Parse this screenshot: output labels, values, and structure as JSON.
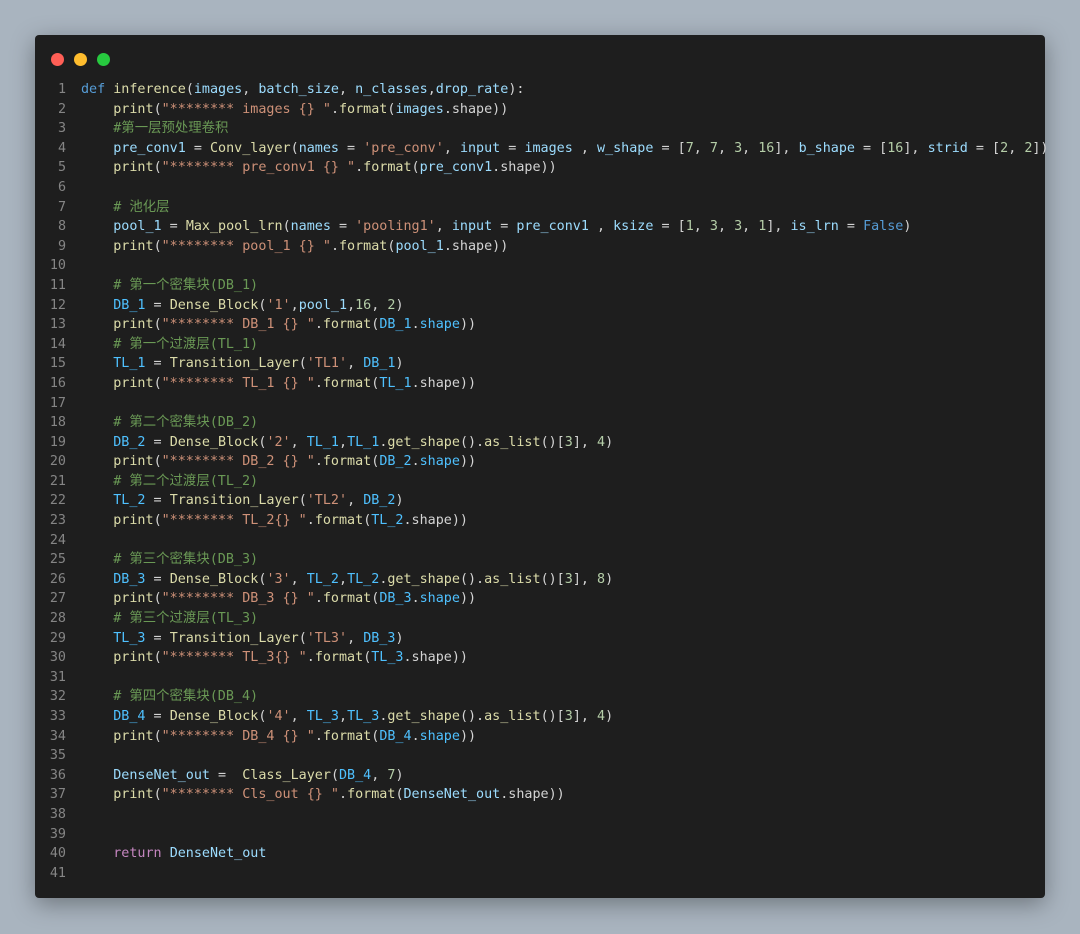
{
  "window_controls": {
    "close_color": "#ff5f56",
    "minimize_color": "#ffbd2e",
    "maximize_color": "#27c93f"
  },
  "code": {
    "language": "python",
    "line_numbers": [
      "1",
      "2",
      "3",
      "4",
      "5",
      "6",
      "7",
      "8",
      "9",
      "10",
      "11",
      "12",
      "13",
      "14",
      "15",
      "16",
      "17",
      "18",
      "19",
      "20",
      "21",
      "22",
      "23",
      "24",
      "25",
      "26",
      "27",
      "28",
      "29",
      "30",
      "31",
      "32",
      "33",
      "34",
      "35",
      "36",
      "37",
      "38",
      "39",
      "40",
      "41"
    ],
    "lines": [
      [
        [
          "kw",
          "def "
        ],
        [
          "fn",
          "inference"
        ],
        [
          "op",
          "("
        ],
        [
          "var",
          "images"
        ],
        [
          "op",
          ", "
        ],
        [
          "var",
          "batch_size"
        ],
        [
          "op",
          ", "
        ],
        [
          "var",
          "n_classes"
        ],
        [
          "op",
          ","
        ],
        [
          "var",
          "drop_rate"
        ],
        [
          "op",
          "):"
        ]
      ],
      [
        [
          "op",
          "    "
        ],
        [
          "fn",
          "print"
        ],
        [
          "op",
          "("
        ],
        [
          "str",
          "\"******** images {} \""
        ],
        [
          "op",
          "."
        ],
        [
          "fn",
          "format"
        ],
        [
          "op",
          "("
        ],
        [
          "var",
          "images"
        ],
        [
          "op",
          ".shape))"
        ]
      ],
      [
        [
          "op",
          "    "
        ],
        [
          "cm",
          "#第一层预处理卷积"
        ]
      ],
      [
        [
          "op",
          "    "
        ],
        [
          "var",
          "pre_conv1"
        ],
        [
          "op",
          " = "
        ],
        [
          "fn",
          "Conv_layer"
        ],
        [
          "op",
          "("
        ],
        [
          "var",
          "names"
        ],
        [
          "op",
          " = "
        ],
        [
          "str",
          "'pre_conv'"
        ],
        [
          "op",
          ", "
        ],
        [
          "var",
          "input"
        ],
        [
          "op",
          " = "
        ],
        [
          "var",
          "images"
        ],
        [
          "op",
          " , "
        ],
        [
          "var",
          "w_shape"
        ],
        [
          "op",
          " = ["
        ],
        [
          "num",
          "7"
        ],
        [
          "op",
          ", "
        ],
        [
          "num",
          "7"
        ],
        [
          "op",
          ", "
        ],
        [
          "num",
          "3"
        ],
        [
          "op",
          ", "
        ],
        [
          "num",
          "16"
        ],
        [
          "op",
          "], "
        ],
        [
          "var",
          "b_shape"
        ],
        [
          "op",
          " = ["
        ],
        [
          "num",
          "16"
        ],
        [
          "op",
          "], "
        ],
        [
          "var",
          "strid"
        ],
        [
          "op",
          " = ["
        ],
        [
          "num",
          "2"
        ],
        [
          "op",
          ", "
        ],
        [
          "num",
          "2"
        ],
        [
          "op",
          "])"
        ]
      ],
      [
        [
          "op",
          "    "
        ],
        [
          "fn",
          "print"
        ],
        [
          "op",
          "("
        ],
        [
          "str",
          "\"******** pre_conv1 {} \""
        ],
        [
          "op",
          "."
        ],
        [
          "fn",
          "format"
        ],
        [
          "op",
          "("
        ],
        [
          "var",
          "pre_conv1"
        ],
        [
          "op",
          ".shape))"
        ]
      ],
      [],
      [
        [
          "op",
          "    "
        ],
        [
          "cm",
          "# 池化层"
        ]
      ],
      [
        [
          "op",
          "    "
        ],
        [
          "var",
          "pool_1"
        ],
        [
          "op",
          " = "
        ],
        [
          "fn",
          "Max_pool_lrn"
        ],
        [
          "op",
          "("
        ],
        [
          "var",
          "names"
        ],
        [
          "op",
          " = "
        ],
        [
          "str",
          "'pooling1'"
        ],
        [
          "op",
          ", "
        ],
        [
          "var",
          "input"
        ],
        [
          "op",
          " = "
        ],
        [
          "var",
          "pre_conv1"
        ],
        [
          "op",
          " , "
        ],
        [
          "var",
          "ksize"
        ],
        [
          "op",
          " = ["
        ],
        [
          "num",
          "1"
        ],
        [
          "op",
          ", "
        ],
        [
          "num",
          "3"
        ],
        [
          "op",
          ", "
        ],
        [
          "num",
          "3"
        ],
        [
          "op",
          ", "
        ],
        [
          "num",
          "1"
        ],
        [
          "op",
          "], "
        ],
        [
          "var",
          "is_lrn"
        ],
        [
          "op",
          " = "
        ],
        [
          "kw",
          "False"
        ],
        [
          "op",
          ")"
        ]
      ],
      [
        [
          "op",
          "    "
        ],
        [
          "fn",
          "print"
        ],
        [
          "op",
          "("
        ],
        [
          "str",
          "\"******** pool_1 {} \""
        ],
        [
          "op",
          "."
        ],
        [
          "fn",
          "format"
        ],
        [
          "op",
          "("
        ],
        [
          "var",
          "pool_1"
        ],
        [
          "op",
          ".shape))"
        ]
      ],
      [],
      [
        [
          "op",
          "    "
        ],
        [
          "cm",
          "# 第一个密集块(DB_1)"
        ]
      ],
      [
        [
          "op",
          "    "
        ],
        [
          "cls",
          "DB_1"
        ],
        [
          "op",
          " = "
        ],
        [
          "fn",
          "Dense_Block"
        ],
        [
          "op",
          "("
        ],
        [
          "str",
          "'1'"
        ],
        [
          "op",
          ","
        ],
        [
          "var",
          "pool_1"
        ],
        [
          "op",
          ","
        ],
        [
          "num",
          "16"
        ],
        [
          "op",
          ", "
        ],
        [
          "num",
          "2"
        ],
        [
          "op",
          ")"
        ]
      ],
      [
        [
          "op",
          "    "
        ],
        [
          "fn",
          "print"
        ],
        [
          "op",
          "("
        ],
        [
          "str",
          "\"******** DB_1 {} \""
        ],
        [
          "op",
          "."
        ],
        [
          "fn",
          "format"
        ],
        [
          "op",
          "("
        ],
        [
          "cls",
          "DB_1"
        ],
        [
          "op",
          "."
        ],
        [
          "cls",
          "shape"
        ],
        [
          "op",
          "))"
        ]
      ],
      [
        [
          "op",
          "    "
        ],
        [
          "cm",
          "# 第一个过渡层(TL_1)"
        ]
      ],
      [
        [
          "op",
          "    "
        ],
        [
          "cls",
          "TL_1"
        ],
        [
          "op",
          " = "
        ],
        [
          "fn",
          "Transition_Layer"
        ],
        [
          "op",
          "("
        ],
        [
          "str",
          "'TL1'"
        ],
        [
          "op",
          ", "
        ],
        [
          "cls",
          "DB_1"
        ],
        [
          "op",
          ")"
        ]
      ],
      [
        [
          "op",
          "    "
        ],
        [
          "fn",
          "print"
        ],
        [
          "op",
          "("
        ],
        [
          "str",
          "\"******** TL_1 {} \""
        ],
        [
          "op",
          "."
        ],
        [
          "fn",
          "format"
        ],
        [
          "op",
          "("
        ],
        [
          "cls",
          "TL_1"
        ],
        [
          "op",
          ".shape))"
        ]
      ],
      [],
      [
        [
          "op",
          "    "
        ],
        [
          "cm",
          "# 第二个密集块(DB_2)"
        ]
      ],
      [
        [
          "op",
          "    "
        ],
        [
          "cls",
          "DB_2"
        ],
        [
          "op",
          " = "
        ],
        [
          "fn",
          "Dense_Block"
        ],
        [
          "op",
          "("
        ],
        [
          "str",
          "'2'"
        ],
        [
          "op",
          ", "
        ],
        [
          "cls",
          "TL_1"
        ],
        [
          "op",
          ","
        ],
        [
          "cls",
          "TL_1"
        ],
        [
          "op",
          "."
        ],
        [
          "fn",
          "get_shape"
        ],
        [
          "op",
          "()."
        ],
        [
          "fn",
          "as_list"
        ],
        [
          "op",
          "()["
        ],
        [
          "num",
          "3"
        ],
        [
          "op",
          "], "
        ],
        [
          "num",
          "4"
        ],
        [
          "op",
          ")"
        ]
      ],
      [
        [
          "op",
          "    "
        ],
        [
          "fn",
          "print"
        ],
        [
          "op",
          "("
        ],
        [
          "str",
          "\"******** DB_2 {} \""
        ],
        [
          "op",
          "."
        ],
        [
          "fn",
          "format"
        ],
        [
          "op",
          "("
        ],
        [
          "cls",
          "DB_2"
        ],
        [
          "op",
          "."
        ],
        [
          "cls",
          "shape"
        ],
        [
          "op",
          "))"
        ]
      ],
      [
        [
          "op",
          "    "
        ],
        [
          "cm",
          "# 第二个过渡层(TL_2)"
        ]
      ],
      [
        [
          "op",
          "    "
        ],
        [
          "cls",
          "TL_2"
        ],
        [
          "op",
          " = "
        ],
        [
          "fn",
          "Transition_Layer"
        ],
        [
          "op",
          "("
        ],
        [
          "str",
          "'TL2'"
        ],
        [
          "op",
          ", "
        ],
        [
          "cls",
          "DB_2"
        ],
        [
          "op",
          ")"
        ]
      ],
      [
        [
          "op",
          "    "
        ],
        [
          "fn",
          "print"
        ],
        [
          "op",
          "("
        ],
        [
          "str",
          "\"******** TL_2{} \""
        ],
        [
          "op",
          "."
        ],
        [
          "fn",
          "format"
        ],
        [
          "op",
          "("
        ],
        [
          "cls",
          "TL_2"
        ],
        [
          "op",
          ".shape))"
        ]
      ],
      [],
      [
        [
          "op",
          "    "
        ],
        [
          "cm",
          "# 第三个密集块(DB_3)"
        ]
      ],
      [
        [
          "op",
          "    "
        ],
        [
          "cls",
          "DB_3"
        ],
        [
          "op",
          " = "
        ],
        [
          "fn",
          "Dense_Block"
        ],
        [
          "op",
          "("
        ],
        [
          "str",
          "'3'"
        ],
        [
          "op",
          ", "
        ],
        [
          "cls",
          "TL_2"
        ],
        [
          "op",
          ","
        ],
        [
          "cls",
          "TL_2"
        ],
        [
          "op",
          "."
        ],
        [
          "fn",
          "get_shape"
        ],
        [
          "op",
          "()."
        ],
        [
          "fn",
          "as_list"
        ],
        [
          "op",
          "()["
        ],
        [
          "num",
          "3"
        ],
        [
          "op",
          "], "
        ],
        [
          "num",
          "8"
        ],
        [
          "op",
          ")"
        ]
      ],
      [
        [
          "op",
          "    "
        ],
        [
          "fn",
          "print"
        ],
        [
          "op",
          "("
        ],
        [
          "str",
          "\"******** DB_3 {} \""
        ],
        [
          "op",
          "."
        ],
        [
          "fn",
          "format"
        ],
        [
          "op",
          "("
        ],
        [
          "cls",
          "DB_3"
        ],
        [
          "op",
          "."
        ],
        [
          "cls",
          "shape"
        ],
        [
          "op",
          "))"
        ]
      ],
      [
        [
          "op",
          "    "
        ],
        [
          "cm",
          "# 第三个过渡层(TL_3)"
        ]
      ],
      [
        [
          "op",
          "    "
        ],
        [
          "cls",
          "TL_3"
        ],
        [
          "op",
          " = "
        ],
        [
          "fn",
          "Transition_Layer"
        ],
        [
          "op",
          "("
        ],
        [
          "str",
          "'TL3'"
        ],
        [
          "op",
          ", "
        ],
        [
          "cls",
          "DB_3"
        ],
        [
          "op",
          ")"
        ]
      ],
      [
        [
          "op",
          "    "
        ],
        [
          "fn",
          "print"
        ],
        [
          "op",
          "("
        ],
        [
          "str",
          "\"******** TL_3{} \""
        ],
        [
          "op",
          "."
        ],
        [
          "fn",
          "format"
        ],
        [
          "op",
          "("
        ],
        [
          "cls",
          "TL_3"
        ],
        [
          "op",
          ".shape))"
        ]
      ],
      [],
      [
        [
          "op",
          "    "
        ],
        [
          "cm",
          "# 第四个密集块(DB_4)"
        ]
      ],
      [
        [
          "op",
          "    "
        ],
        [
          "cls",
          "DB_4"
        ],
        [
          "op",
          " = "
        ],
        [
          "fn",
          "Dense_Block"
        ],
        [
          "op",
          "("
        ],
        [
          "str",
          "'4'"
        ],
        [
          "op",
          ", "
        ],
        [
          "cls",
          "TL_3"
        ],
        [
          "op",
          ","
        ],
        [
          "cls",
          "TL_3"
        ],
        [
          "op",
          "."
        ],
        [
          "fn",
          "get_shape"
        ],
        [
          "op",
          "()."
        ],
        [
          "fn",
          "as_list"
        ],
        [
          "op",
          "()["
        ],
        [
          "num",
          "3"
        ],
        [
          "op",
          "], "
        ],
        [
          "num",
          "4"
        ],
        [
          "op",
          ")"
        ]
      ],
      [
        [
          "op",
          "    "
        ],
        [
          "fn",
          "print"
        ],
        [
          "op",
          "("
        ],
        [
          "str",
          "\"******** DB_4 {} \""
        ],
        [
          "op",
          "."
        ],
        [
          "fn",
          "format"
        ],
        [
          "op",
          "("
        ],
        [
          "cls",
          "DB_4"
        ],
        [
          "op",
          "."
        ],
        [
          "cls",
          "shape"
        ],
        [
          "op",
          "))"
        ]
      ],
      [],
      [
        [
          "op",
          "    "
        ],
        [
          "var",
          "DenseNet_out"
        ],
        [
          "op",
          " =  "
        ],
        [
          "fn",
          "Class_Layer"
        ],
        [
          "op",
          "("
        ],
        [
          "cls",
          "DB_4"
        ],
        [
          "op",
          ", "
        ],
        [
          "num",
          "7"
        ],
        [
          "op",
          ")"
        ]
      ],
      [
        [
          "op",
          "    "
        ],
        [
          "fn",
          "print"
        ],
        [
          "op",
          "("
        ],
        [
          "str",
          "\"******** Cls_out {} \""
        ],
        [
          "op",
          "."
        ],
        [
          "fn",
          "format"
        ],
        [
          "op",
          "("
        ],
        [
          "var",
          "DenseNet_out"
        ],
        [
          "op",
          ".shape))"
        ]
      ],
      [],
      [],
      [
        [
          "op",
          "    "
        ],
        [
          "ret",
          "return "
        ],
        [
          "var",
          "DenseNet_out"
        ]
      ],
      []
    ]
  }
}
